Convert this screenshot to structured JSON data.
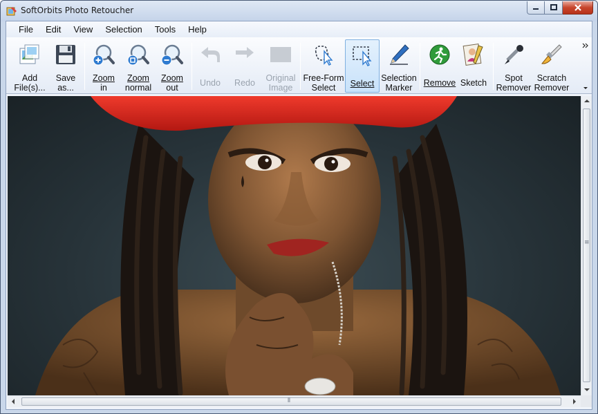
{
  "window": {
    "title": "SoftOrbits Photo Retoucher"
  },
  "menu": [
    "File",
    "Edit",
    "View",
    "Selection",
    "Tools",
    "Help"
  ],
  "toolbar": {
    "add_files": [
      "Add",
      "File(s)..."
    ],
    "save_as": [
      "Save",
      "as..."
    ],
    "zoom_in": [
      "Zoom",
      "in"
    ],
    "zoom_normal": [
      "Zoom",
      "normal"
    ],
    "zoom_out": [
      "Zoom",
      "out"
    ],
    "undo": "Undo",
    "redo": "Redo",
    "original_image": [
      "Original",
      "Image"
    ],
    "free_form_select": [
      "Free-Form",
      "Select"
    ],
    "select": "Select",
    "selection_marker": [
      "Selection",
      "Marker"
    ],
    "remove": "Remove",
    "sketch": "Sketch",
    "spot_remover": [
      "Spot",
      "Remover"
    ],
    "scratch_remover": [
      "Scratch",
      "Remover"
    ]
  },
  "icons": {
    "app": "retoucher-app-icon",
    "overflow": "toolbar-overflow-chevron-icon"
  },
  "colors": {
    "accent_select": "#c8e2fa",
    "close_button": "#c7452c",
    "hat_red": "#d9211c"
  }
}
